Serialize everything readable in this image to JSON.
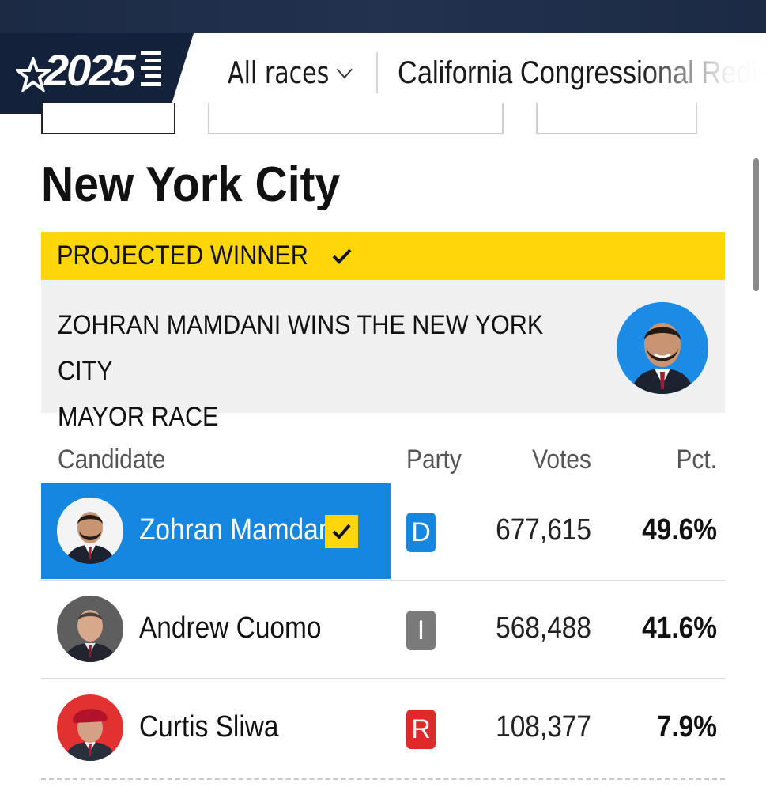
{
  "header": {
    "logo_year": "2025",
    "races_dropdown_label": "All races",
    "race_link_label": "California Congressional Redis"
  },
  "page": {
    "title": "New York City"
  },
  "projected_winner": {
    "banner_label": "PROJECTED WINNER",
    "headline_line1": "ZOHRAN MAMDANI WINS THE NEW YORK CITY",
    "headline_line2": "MAYOR RACE"
  },
  "table": {
    "columns": {
      "candidate": "Candidate",
      "party": "Party",
      "votes": "Votes",
      "pct": "Pct."
    },
    "rows": [
      {
        "name": "Zohran Mamdani",
        "party": "D",
        "party_color": "#1587e0",
        "votes": "677,615",
        "pct": "49.6%",
        "winner": true
      },
      {
        "name": "Andrew Cuomo",
        "party": "I",
        "party_color": "#7a7a7a",
        "votes": "568,488",
        "pct": "41.6%",
        "winner": false
      },
      {
        "name": "Curtis Sliwa",
        "party": "R",
        "party_color": "#e02a2a",
        "votes": "108,377",
        "pct": "7.9%",
        "winner": false
      }
    ]
  },
  "colors": {
    "winner_highlight": "#1587e0",
    "banner_yellow": "#ffd60a",
    "header_navy": "#14213a"
  }
}
